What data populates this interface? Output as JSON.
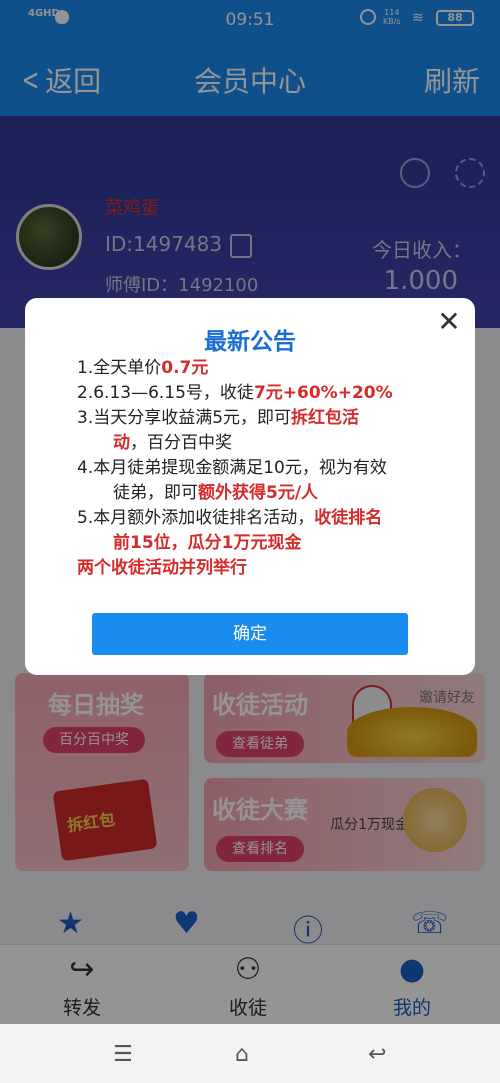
{
  "status_bar": {
    "network": "4GHD",
    "time": "09:51",
    "speed_value": "114",
    "speed_unit": "KB/s",
    "battery": "88"
  },
  "nav": {
    "back_label": "返回",
    "title": "会员中心",
    "refresh_label": "刷新"
  },
  "profile": {
    "name": "菜鸡蛋",
    "id_text": "ID:1497483",
    "master_text": "师傅ID：1492100",
    "income_label": "今日收入：",
    "income_value": "1.000"
  },
  "cards": {
    "lottery": {
      "title": "每日抽奖",
      "pill": "百分百中奖",
      "envelope_text": "拆红包"
    },
    "activity": {
      "title": "收徒活动",
      "pill": "查看徒弟",
      "side": "邀请好友"
    },
    "contest": {
      "title": "收徒大赛",
      "pill": "查看排名",
      "side": "瓜分1万现金"
    }
  },
  "tabs": [
    {
      "label": "转发",
      "icon": "share-icon"
    },
    {
      "label": "收徒",
      "icon": "people-icon"
    },
    {
      "label": "我的",
      "icon": "person-icon"
    }
  ],
  "dialog": {
    "title": "最新公告",
    "items": {
      "l1a": "1.全天单价",
      "l1b": "0.7元",
      "l2a": "2.6.13—6.15号，收徒",
      "l2b": "7元+60%+20%",
      "l3a": "3.当天分享收益满5元，即可",
      "l3b": "拆红包活",
      "l3c": "动",
      "l3d": "，百分百中奖",
      "l4a": "4.本月徒弟提现金额满足10元，视为有效",
      "l4b": "徒弟，即可",
      "l4c": "额外获得5元/人",
      "l5a": "5.本月额外添加收徒排名活动，",
      "l5b": "收徒排名",
      "l5c": "前15位，瓜分1万元现金",
      "l6": "两个收徒活动并列举行"
    },
    "confirm_label": "确定"
  },
  "colors": {
    "primary": "#1a8bef",
    "highlight_red": "#d62b2b",
    "title_blue": "#1a6fd6"
  }
}
